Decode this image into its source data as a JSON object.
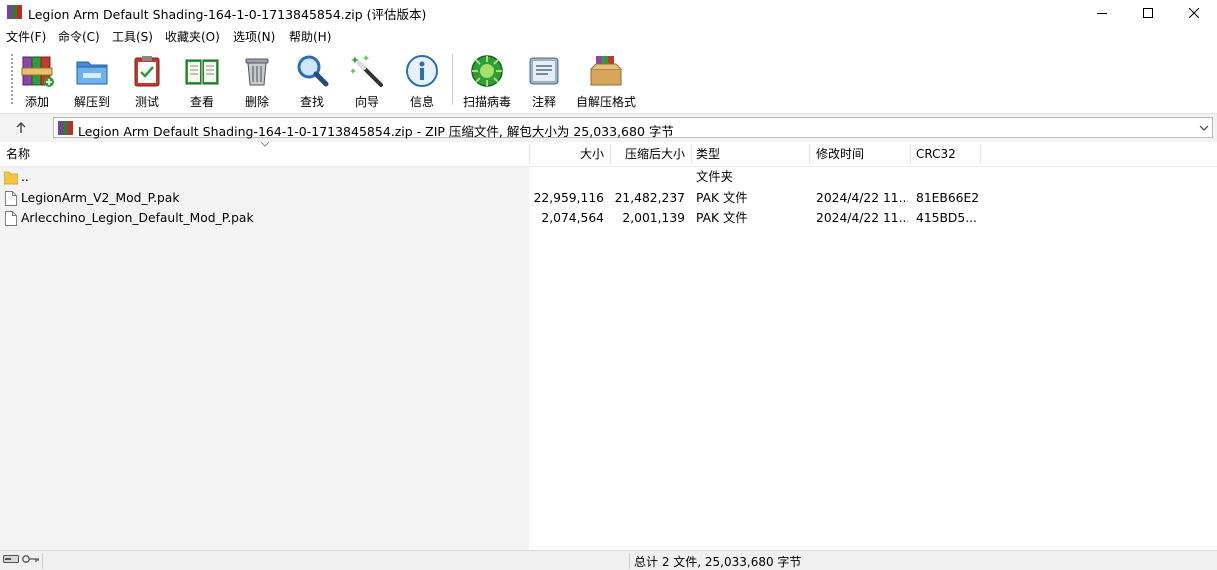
{
  "window": {
    "title": "Legion Arm Default Shading-164-1-0-1713845854.zip (评估版本)",
    "app_icon": "winrar-books-icon",
    "controls": [
      "minimize-icon",
      "maximize-icon",
      "close-icon"
    ]
  },
  "menu": [
    "文件(F)",
    "命令(C)",
    "工具(S)",
    "收藏夹(O)",
    "选项(N)",
    "帮助(H)"
  ],
  "toolbar": [
    {
      "label": "添加",
      "icon": "add-archive-icon"
    },
    {
      "label": "解压到",
      "icon": "extract-folder-icon"
    },
    {
      "label": "测试",
      "icon": "test-clipboard-icon"
    },
    {
      "label": "查看",
      "icon": "view-book-icon"
    },
    {
      "label": "删除",
      "icon": "delete-trash-icon"
    },
    {
      "label": "查找",
      "icon": "find-magnifier-icon"
    },
    {
      "label": "向导",
      "icon": "wizard-wand-icon"
    },
    {
      "label": "信息",
      "icon": "info-icon"
    },
    {
      "label": "扫描病毒",
      "icon": "virus-scan-icon"
    },
    {
      "label": "注释",
      "icon": "comment-icon"
    },
    {
      "label": "自解压格式",
      "icon": "sfx-box-icon"
    }
  ],
  "address": {
    "text": "Legion Arm Default Shading-164-1-0-1713845854.zip - ZIP 压缩文件, 解包大小为 25,033,680 字节"
  },
  "columns": {
    "name": "名称",
    "size": "大小",
    "packed": "压缩后大小",
    "type": "类型",
    "modified": "修改时间",
    "crc": "CRC32"
  },
  "rows": [
    {
      "name": "..",
      "size": "",
      "packed": "",
      "type": "文件夹",
      "modified": "",
      "crc": "",
      "kind": "folder"
    },
    {
      "name": "LegionArm_V2_Mod_P.pak",
      "size": "22,959,116",
      "packed": "21,482,237",
      "type": "PAK 文件",
      "modified": "2024/4/22 11...",
      "crc": "81EB66E2",
      "kind": "file"
    },
    {
      "name": "Arlecchino_Legion_Default_Mod_P.pak",
      "size": "2,074,564",
      "packed": "2,001,139",
      "type": "PAK 文件",
      "modified": "2024/4/22 11...",
      "crc": "415BD5...",
      "kind": "file"
    }
  ],
  "status": {
    "summary": "总计 2 文件, 25,033,680 字节",
    "left_icons": [
      "drive-icon",
      "key-icon"
    ]
  },
  "colors": {
    "accent_green": "#2e9e3a",
    "folder_yellow": "#f5c542",
    "panel_gray": "#f3f3f3"
  }
}
